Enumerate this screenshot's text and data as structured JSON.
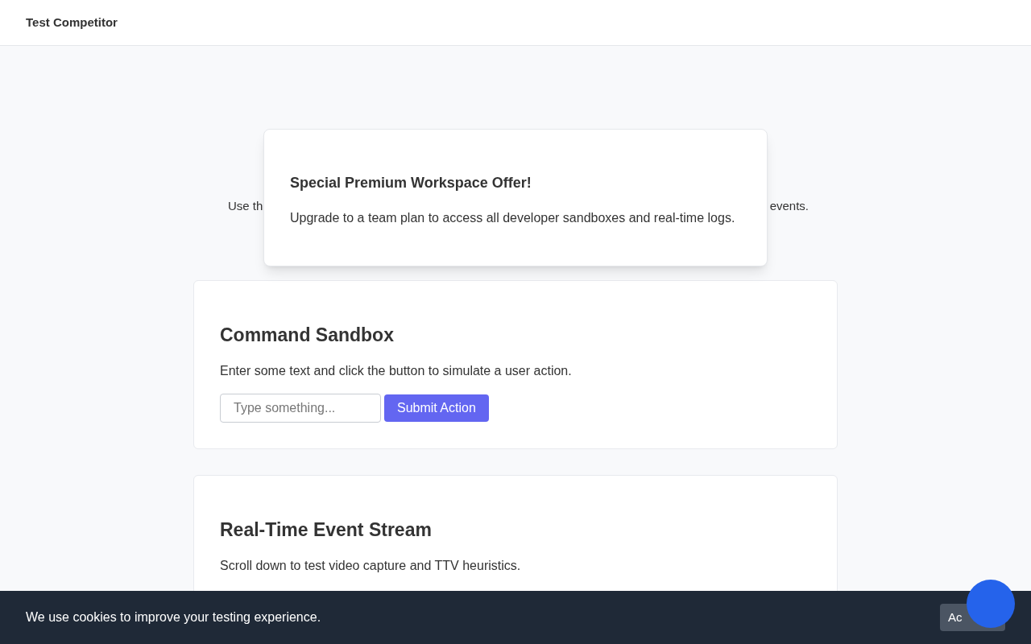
{
  "header": {
    "title": "Test Competitor"
  },
  "intro": {
    "left_fragment": "Use th",
    "right_fragment": "events."
  },
  "popup": {
    "title": "Special Premium Workspace Offer!",
    "body": "Upgrade to a team plan to access all developer sandboxes and real-time logs."
  },
  "cards": [
    {
      "title": "Command Sandbox",
      "text": "Enter some text and click the button to simulate a user action.",
      "input": {
        "placeholder": "Type something..."
      },
      "button": "Submit Action"
    },
    {
      "title": "Real-Time Event Stream",
      "text": "Scroll down to test video capture and TTV heuristics."
    }
  ],
  "cookie_bar": {
    "message": "We use cookies to improve your testing experience.",
    "button": "Ac"
  }
}
